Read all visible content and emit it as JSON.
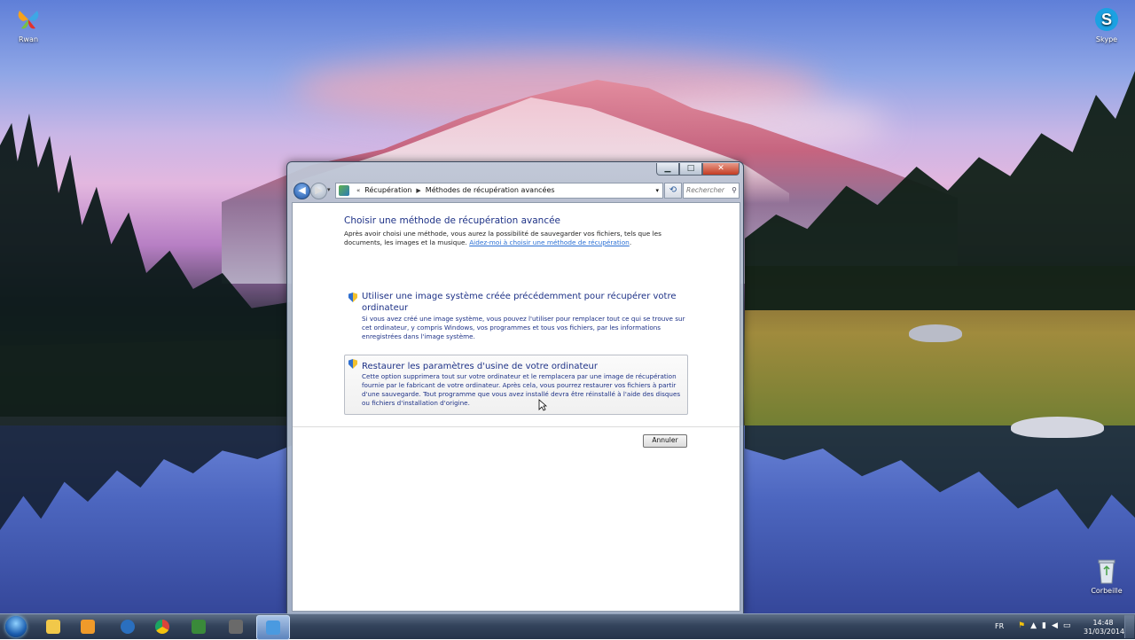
{
  "desktop": {
    "icons": [
      {
        "label": "Rwan",
        "icon": "msn-butterfly-icon"
      },
      {
        "label": "Skype",
        "icon": "skype-icon"
      },
      {
        "label": "Corbeille",
        "icon": "recycle-bin-icon"
      }
    ]
  },
  "window": {
    "caption_buttons": {
      "minimize": "▁",
      "maximize": "□",
      "close": "✕"
    },
    "breadcrumb": [
      "Récupération",
      "Méthodes de récupération avancées"
    ],
    "search_placeholder": "Rechercher",
    "title": "Choisir une méthode de récupération avancée",
    "intro_text": "Après avoir choisi une méthode, vous aurez la possibilité de sauvegarder vos fichiers, tels que les documents, les images et la musique.",
    "intro_link": "Aidez-moi à choisir une méthode de récupération",
    "intro_end": ".",
    "options": [
      {
        "heading": "Utiliser une image système créée précédemment pour récupérer votre ordinateur",
        "description": "Si vous avez créé une image système, vous pouvez l'utiliser pour remplacer tout ce qui se trouve sur cet ordinateur, y compris Windows, vos programmes et tous vos fichiers, par les informations enregistrées dans l'image système."
      },
      {
        "heading": "Restaurer les paramètres d'usine de votre ordinateur",
        "description": "Cette option supprimera tout sur votre ordinateur et le remplacera par une image de récupération fournie par le fabricant de votre ordinateur. Après cela, vous pourrez restaurer vos fichiers à partir d'une sauvegarde. Tout programme que vous avez installé devra être réinstallé à l'aide des disques ou fichiers d'installation d'origine."
      }
    ],
    "cancel_label": "Annuler"
  },
  "taskbar": {
    "pinned": [
      {
        "name": "explorer",
        "icon": "folder-icon",
        "color": "#f1c84a"
      },
      {
        "name": "media-player",
        "icon": "media-player-icon",
        "color": "#f09a2a"
      },
      {
        "name": "hp",
        "icon": "hp-icon",
        "color": "#2a6fbf"
      },
      {
        "name": "chrome",
        "icon": "chrome-icon",
        "color": "#d9443a"
      },
      {
        "name": "app-green",
        "icon": "green-app-icon",
        "color": "#3a8a3a"
      },
      {
        "name": "app-chess",
        "icon": "chess-app-icon",
        "color": "#6a6a6a"
      },
      {
        "name": "control-panel",
        "icon": "control-panel-icon",
        "color": "#4a9ae0"
      }
    ],
    "language": "FR",
    "time": "14:48",
    "date": "31/03/2014"
  }
}
